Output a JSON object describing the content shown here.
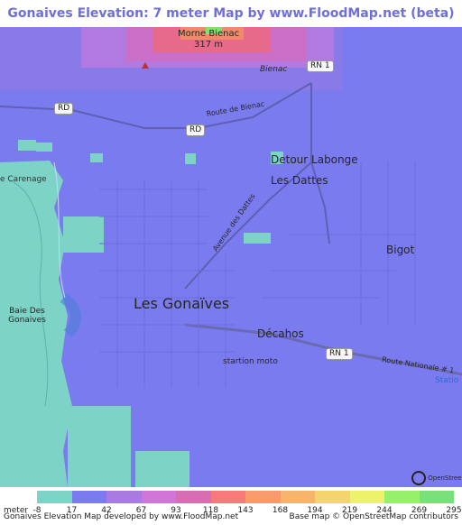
{
  "title": "Gonaives Elevation: 7 meter Map by www.FloodMap.net (beta)",
  "map": {
    "places": {
      "morne_bienac": "Morne Bienac",
      "peak_elevation": "317 m",
      "bienac": "Bienac",
      "route_de_bienac": "Route de Bienac",
      "detour_labonge": "Detour Labonge",
      "les_dattes": "Les Dattes",
      "carenage": "e Carenage",
      "avenue_des_dattes": "Avenue des Dattes",
      "bigot": "Bigot",
      "les_gonaives": "Les Gonaïves",
      "baie_des_gonaives": "Baie Des Gonaives",
      "decahos": "Décahos",
      "startion_moto": "startion moto",
      "route_nationale_1": "Route Nationale # 1",
      "station": "Statio"
    },
    "road_shields": {
      "rd_west": "RD",
      "rd_mid": "RD",
      "rn1_north": "RN 1",
      "rn1_east": "RN 1"
    },
    "osm_logo_text": "OpenStreetMap",
    "colors": {
      "sea": "#7cd3c6",
      "low": "#7a7af0",
      "mid": "#a07ae6",
      "high": "#d070d0",
      "peak": "#f07070"
    }
  },
  "legend": {
    "unit_label": "meter",
    "ticks": [
      "-8",
      "17",
      "42",
      "67",
      "93",
      "118",
      "143",
      "168",
      "194",
      "219",
      "244",
      "269",
      "295"
    ],
    "colors": [
      "#7cd3c6",
      "#7b7bf0",
      "#a97ae0",
      "#cf76d6",
      "#d56fb1",
      "#f77a7a",
      "#f79a6c",
      "#f7b46c",
      "#f4d46c",
      "#eef26a",
      "#96f06c",
      "#7ae07a"
    ]
  },
  "footer": {
    "left": "Gonaives Elevation Map developed by www.FloodMap.net",
    "right": "Base map © OpenStreetMap contributors"
  }
}
